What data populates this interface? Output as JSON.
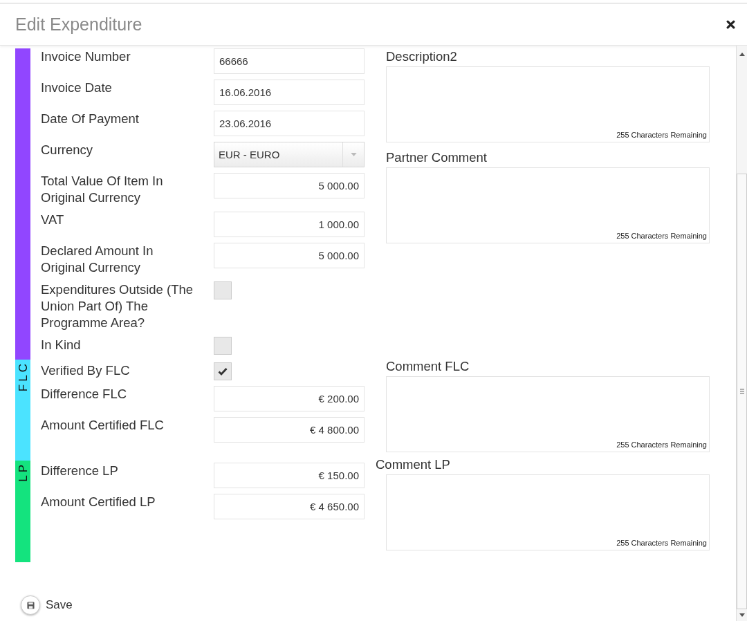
{
  "dialog": {
    "title": "Edit Expenditure"
  },
  "sections": [
    {
      "color": "#9146ff",
      "rows": [
        {
          "kind": "text",
          "label": "Invoice Number",
          "value": "66666"
        },
        {
          "kind": "text",
          "label": "Invoice Date",
          "value": "16.06.2016"
        },
        {
          "kind": "text",
          "label": "Date Of Payment",
          "value": "23.06.2016"
        },
        {
          "kind": "select",
          "label": "Currency",
          "value": "EUR - EURO"
        },
        {
          "kind": "amount",
          "label": "Total Value Of Item In Original Currency",
          "value": "5 000.00"
        },
        {
          "kind": "amount",
          "label": "VAT",
          "value": "1 000.00"
        },
        {
          "kind": "amount",
          "label": "Declared Amount In Original Currency",
          "value": "5 000.00"
        },
        {
          "kind": "checkbox",
          "label": "Expenditures Outside (The Union Part Of) The Programme Area?",
          "checked": false
        },
        {
          "kind": "checkbox",
          "label": "In Kind",
          "checked": false
        }
      ]
    },
    {
      "label": "FLC",
      "color": "#4be3ff",
      "rows": [
        {
          "kind": "checkbox",
          "label": "Verified By FLC",
          "checked": true
        },
        {
          "kind": "amount",
          "label": "Difference FLC",
          "value": "€ 200.00"
        },
        {
          "kind": "amount",
          "label": "Amount Certified FLC",
          "value": "€ 4 800.00"
        }
      ]
    },
    {
      "label": "LP",
      "color": "#14e37e",
      "rows": [
        {
          "kind": "amount",
          "label": "Difference LP",
          "value": "€ 150.00"
        },
        {
          "kind": "amount",
          "label": "Amount Certified LP",
          "value": "€ 4 650.00"
        }
      ]
    }
  ],
  "comments": [
    {
      "label": "Description2",
      "counter": "255 Characters Remaining"
    },
    {
      "label": "Partner Comment",
      "counter": "255 Characters Remaining"
    },
    {
      "label": "Comment FLC",
      "counter": "255 Characters Remaining"
    },
    {
      "label": "Comment LP",
      "counter": "255 Characters Remaining"
    }
  ],
  "save_button": {
    "label": "Save"
  }
}
